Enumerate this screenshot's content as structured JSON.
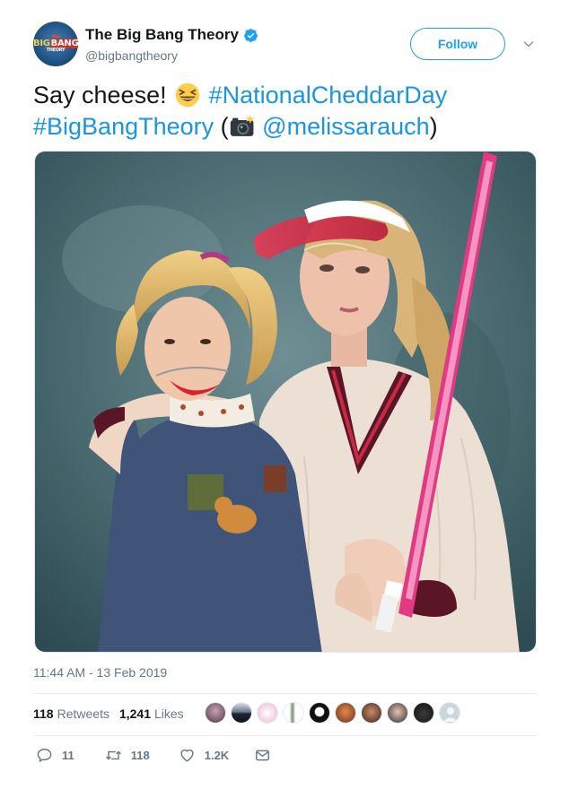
{
  "account": {
    "display_name": "The Big Bang Theory",
    "handle": "@bigbangtheory",
    "avatar_logo": {
      "top": "the",
      "word1": "BIG",
      "word2": "BANG",
      "bottom": "THEORY"
    }
  },
  "follow_label": "Follow",
  "tweet": {
    "line1_text": "Say cheese!",
    "hashtag1": "#NationalCheddarDay",
    "hashtag2": "#BigBangTheory",
    "paren_open": "(",
    "mention": "@melissarauch",
    "paren_close": ")"
  },
  "timestamp": "11:44 AM - 13 Feb 2019",
  "stats": {
    "retweets_count": "118",
    "retweets_label": "Retweets",
    "likes_count": "1,241",
    "likes_label": "Likes"
  },
  "actions": {
    "reply_count": "11",
    "retweet_count": "118",
    "like_count": "1.2K"
  },
  "colors": {
    "link": "#1b95e0",
    "follow_accent": "#1da1f2",
    "secondary_text": "#657786",
    "verified": "#1da1f2"
  },
  "icons": [
    "verified-badge-icon",
    "chevron-down-icon",
    "laughing-emoji-icon",
    "camera-flash-emoji-icon",
    "reply-icon",
    "retweet-icon",
    "heart-icon",
    "envelope-icon"
  ]
}
